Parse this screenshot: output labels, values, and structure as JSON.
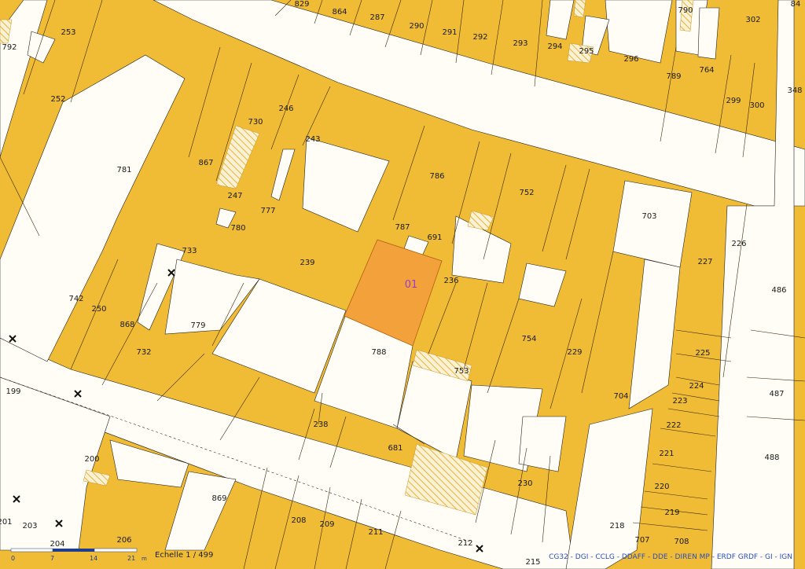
{
  "map": {
    "selected_parcel": "01",
    "parcels": [
      "829",
      "864",
      "287",
      "290",
      "291",
      "292",
      "293",
      "294",
      "295",
      "296",
      "790",
      "302",
      "84",
      "792",
      "253",
      "252",
      "789",
      "764",
      "299",
      "300",
      "348",
      "730",
      "246",
      "243",
      "781",
      "867",
      "786",
      "752",
      "703",
      "247",
      "777",
      "780",
      "787",
      "691",
      "239",
      "226",
      "227",
      "733",
      "742",
      "250",
      "868",
      "779",
      "236",
      "754",
      "486",
      "732",
      "788",
      "753",
      "229",
      "225",
      "224",
      "223",
      "222",
      "221",
      "220",
      "219",
      "218",
      "707",
      "708",
      "704",
      "487",
      "488",
      "199",
      "238",
      "681",
      "230",
      "200",
      "869",
      "208",
      "209",
      "211",
      "212",
      "215",
      "201",
      "203",
      "204",
      "206"
    ],
    "scale": {
      "label": "Echelle 1 / 499",
      "ticks": [
        "0",
        "7",
        "14",
        "21"
      ],
      "unit": "m"
    },
    "credits": "CG32 - DGI - CCLG - DDAFF - DDE - DIREN MP - ERDF GRDF - GI - IGN"
  }
}
